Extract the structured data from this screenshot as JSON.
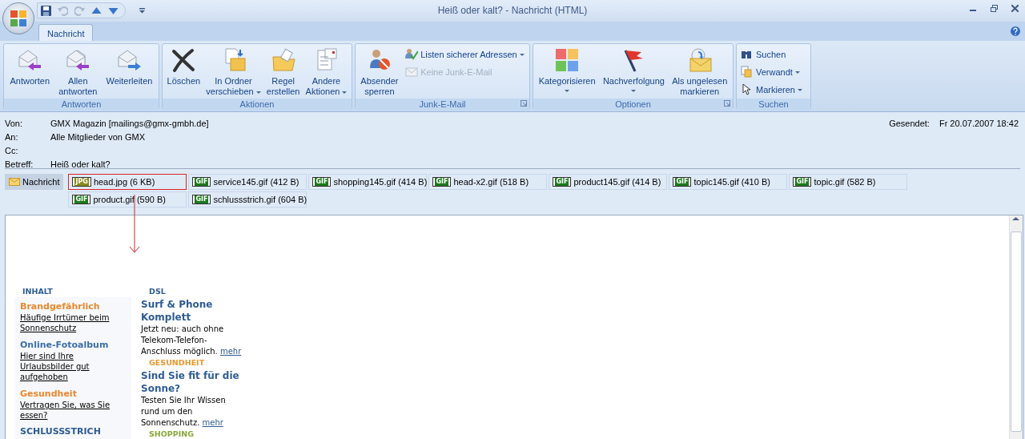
{
  "window": {
    "title": "Heiß oder kalt? - Nachricht (HTML)"
  },
  "ribbon_tabs": [
    {
      "label": "Nachricht",
      "selected": true
    }
  ],
  "ribbon_groups": [
    {
      "label": "Antworten",
      "launcher": false,
      "buttons": [
        {
          "kind": "large",
          "label": "Antworten",
          "dropdown": false,
          "disabled": false
        },
        {
          "kind": "large",
          "label": "Allen\nantworten",
          "dropdown": false,
          "disabled": false
        },
        {
          "kind": "large",
          "label": "Weiterleiten",
          "dropdown": false,
          "disabled": false
        }
      ]
    },
    {
      "label": "Aktionen",
      "launcher": false,
      "buttons": [
        {
          "kind": "large",
          "label": "Löschen",
          "dropdown": false,
          "disabled": false
        },
        {
          "kind": "large",
          "label": "In Ordner\nverschieben",
          "dropdown": true,
          "disabled": false
        },
        {
          "kind": "large",
          "label": "Regel\nerstellen",
          "dropdown": false,
          "disabled": false
        },
        {
          "kind": "large",
          "label": "Andere\nAktionen",
          "dropdown": true,
          "disabled": false
        }
      ]
    },
    {
      "label": "Junk-E-Mail",
      "launcher": true,
      "buttons": [
        {
          "kind": "large",
          "label": "Absender\nsperren",
          "dropdown": false,
          "disabled": false
        },
        {
          "kind": "small",
          "label": "Listen sicherer Adressen",
          "dropdown": true,
          "disabled": false
        },
        {
          "kind": "small",
          "label": "Keine Junk-E-Mail",
          "dropdown": false,
          "disabled": true
        }
      ]
    },
    {
      "label": "Optionen",
      "launcher": true,
      "buttons": [
        {
          "kind": "large",
          "label": "Kategorisieren",
          "dropdown": true,
          "disabled": false
        },
        {
          "kind": "large",
          "label": "Nachverfolgung",
          "dropdown": true,
          "disabled": false
        },
        {
          "kind": "large",
          "label": "Als ungelesen\nmarkieren",
          "dropdown": false,
          "disabled": false
        }
      ]
    },
    {
      "label": "Suchen",
      "launcher": false,
      "buttons": [
        {
          "kind": "small",
          "label": "Suchen",
          "dropdown": false,
          "disabled": false
        },
        {
          "kind": "small",
          "label": "Verwandt",
          "dropdown": true,
          "disabled": false
        },
        {
          "kind": "small",
          "label": "Markieren",
          "dropdown": true,
          "disabled": false
        }
      ]
    }
  ],
  "header": [
    {
      "label": "Von:",
      "value": "GMX Magazin [mailings@gmx-gmbh.de]"
    },
    {
      "label": "An:",
      "value": "Alle Mitglieder von GMX"
    },
    {
      "label": "Cc:"
    },
    {
      "label": "Betreff:",
      "value": "Heiß oder kalt?"
    }
  ],
  "sent": {
    "label": "Gesendet:",
    "value": "Fr 20.07.2007 18:42"
  },
  "message_tab": {
    "label": "Nachricht",
    "selected": true
  },
  "attachments": [
    {
      "type": "JPG",
      "name": "head.jpg (6 KB)",
      "selected": true
    },
    {
      "type": "GIF",
      "name": "service145.gif (412 B)",
      "selected": false
    },
    {
      "type": "GIF",
      "name": "shopping145.gif (414 B)",
      "selected": false
    },
    {
      "type": "GIF",
      "name": "head-x2.gif (518 B)",
      "selected": false
    },
    {
      "type": "GIF",
      "name": "product145.gif (414 B)",
      "selected": false
    },
    {
      "type": "GIF",
      "name": "topic145.gif (410 B)",
      "selected": false
    },
    {
      "type": "GIF",
      "name": "topic.gif (582 B)",
      "selected": false
    },
    {
      "type": "GIF",
      "name": "product.gif (590 B)",
      "selected": false
    },
    {
      "type": "GIF",
      "name": "schlussstrich.gif (604 B)",
      "selected": false
    }
  ],
  "body": {
    "sidebar": {
      "heading": "INHALT",
      "items": [
        {
          "category": "Brandgefährlich",
          "color": "#e8892f",
          "link": "Häufige Irrtümer beim Sonnenschutz"
        },
        {
          "category": "Online-Fotoalbum",
          "color": "#3d6fa8",
          "link": "Hier sind Ihre Urlaubsbilder gut aufgehoben"
        },
        {
          "category": "Gesundheit",
          "color": "#e8892f",
          "link": "Vertragen Sie, was Sie essen?"
        }
      ],
      "footer": "SCHLUSSSTRICH"
    },
    "sections": [
      {
        "label": "DSL",
        "color": "#2f5c94",
        "title": "Surf & Phone Komplett",
        "text": "Jetzt neu: auch ohne Telekom-Telefon-Anschluss möglich.",
        "link": "mehr"
      },
      {
        "label": "GESUNDHEIT",
        "color": "#e8992f",
        "title": "Sind Sie fit für die Sonne?",
        "text": "Testen Sie Ihr Wissen rund um den Sonnenschutz.",
        "link": "mehr"
      },
      {
        "label": "SHOPPING",
        "color": "#8aa83c"
      }
    ]
  }
}
